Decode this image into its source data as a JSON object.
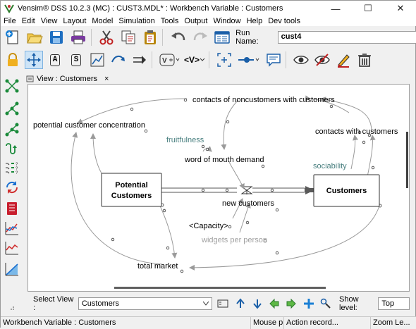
{
  "window": {
    "title": "Vensim® DSS 10.2.3 (MC) : CUST3.MDL* : Workbench Variable : Customers",
    "minimize": "—",
    "maximize": "☐",
    "close": "✕"
  },
  "menu": [
    "File",
    "Edit",
    "View",
    "Layout",
    "Model",
    "Simulation",
    "Tools",
    "Output",
    "Window",
    "Help",
    "Dev tools"
  ],
  "toolbar": {
    "run_name_label": "Run Name:",
    "run_name_value": "cust4",
    "icons": [
      "new-model-icon",
      "open-model-icon",
      "save-icon",
      "print-icon",
      "cut-icon",
      "copy-icon",
      "paste-icon",
      "undo-icon",
      "redo-icon",
      "run-settings-icon"
    ]
  },
  "sketch_tools": {
    "variable_label": "A",
    "box_label": "S",
    "shadow_label": "<V>",
    "icons": [
      "lock-icon",
      "move-icon",
      "variable-tool-icon",
      "box-variable-tool-icon",
      "arrow-tool-icon",
      "rate-tool-icon",
      "flow-tool-icon",
      "shadow-variable-icon",
      "input-output-icon",
      "sketch-comment-icon",
      "unhide-icon",
      "hide-icon",
      "delete-icon"
    ]
  },
  "view_tab": {
    "label": "View : Customers",
    "close": "×"
  },
  "diagram": {
    "stocks": {
      "potential": "Potential\nCustomers",
      "potential_l1": "Potential",
      "potential_l2": "Customers",
      "customers": "Customers"
    },
    "variables": {
      "contacts_non": "contacts of noncustomers with customers",
      "pot_conc": "potential customer concentration",
      "fruitfulness": "fruitfulness",
      "wom_demand": "word of mouth demand",
      "contacts_with": "contacts with customers",
      "sociability": "sociability",
      "new_customers": "new customers",
      "capacity": "<Capacity>",
      "widgets": "widgets per person",
      "total_market": "total market"
    }
  },
  "bottom": {
    "select_view_label": "Select View :",
    "select_view_value": "Customers",
    "show_level_label": "Show level:",
    "show_level_value": "Top"
  },
  "status": {
    "left": "Workbench Variable : Customers",
    "mouse": "Mouse p...",
    "action": "Action record...",
    "zoom": "Zoom Le..."
  },
  "colors": {
    "parameter_text": "#4a8080",
    "shadow_text": "#a0a0a0",
    "link": "#9a9a9a",
    "flow_arrow": "#5a5a5a"
  }
}
